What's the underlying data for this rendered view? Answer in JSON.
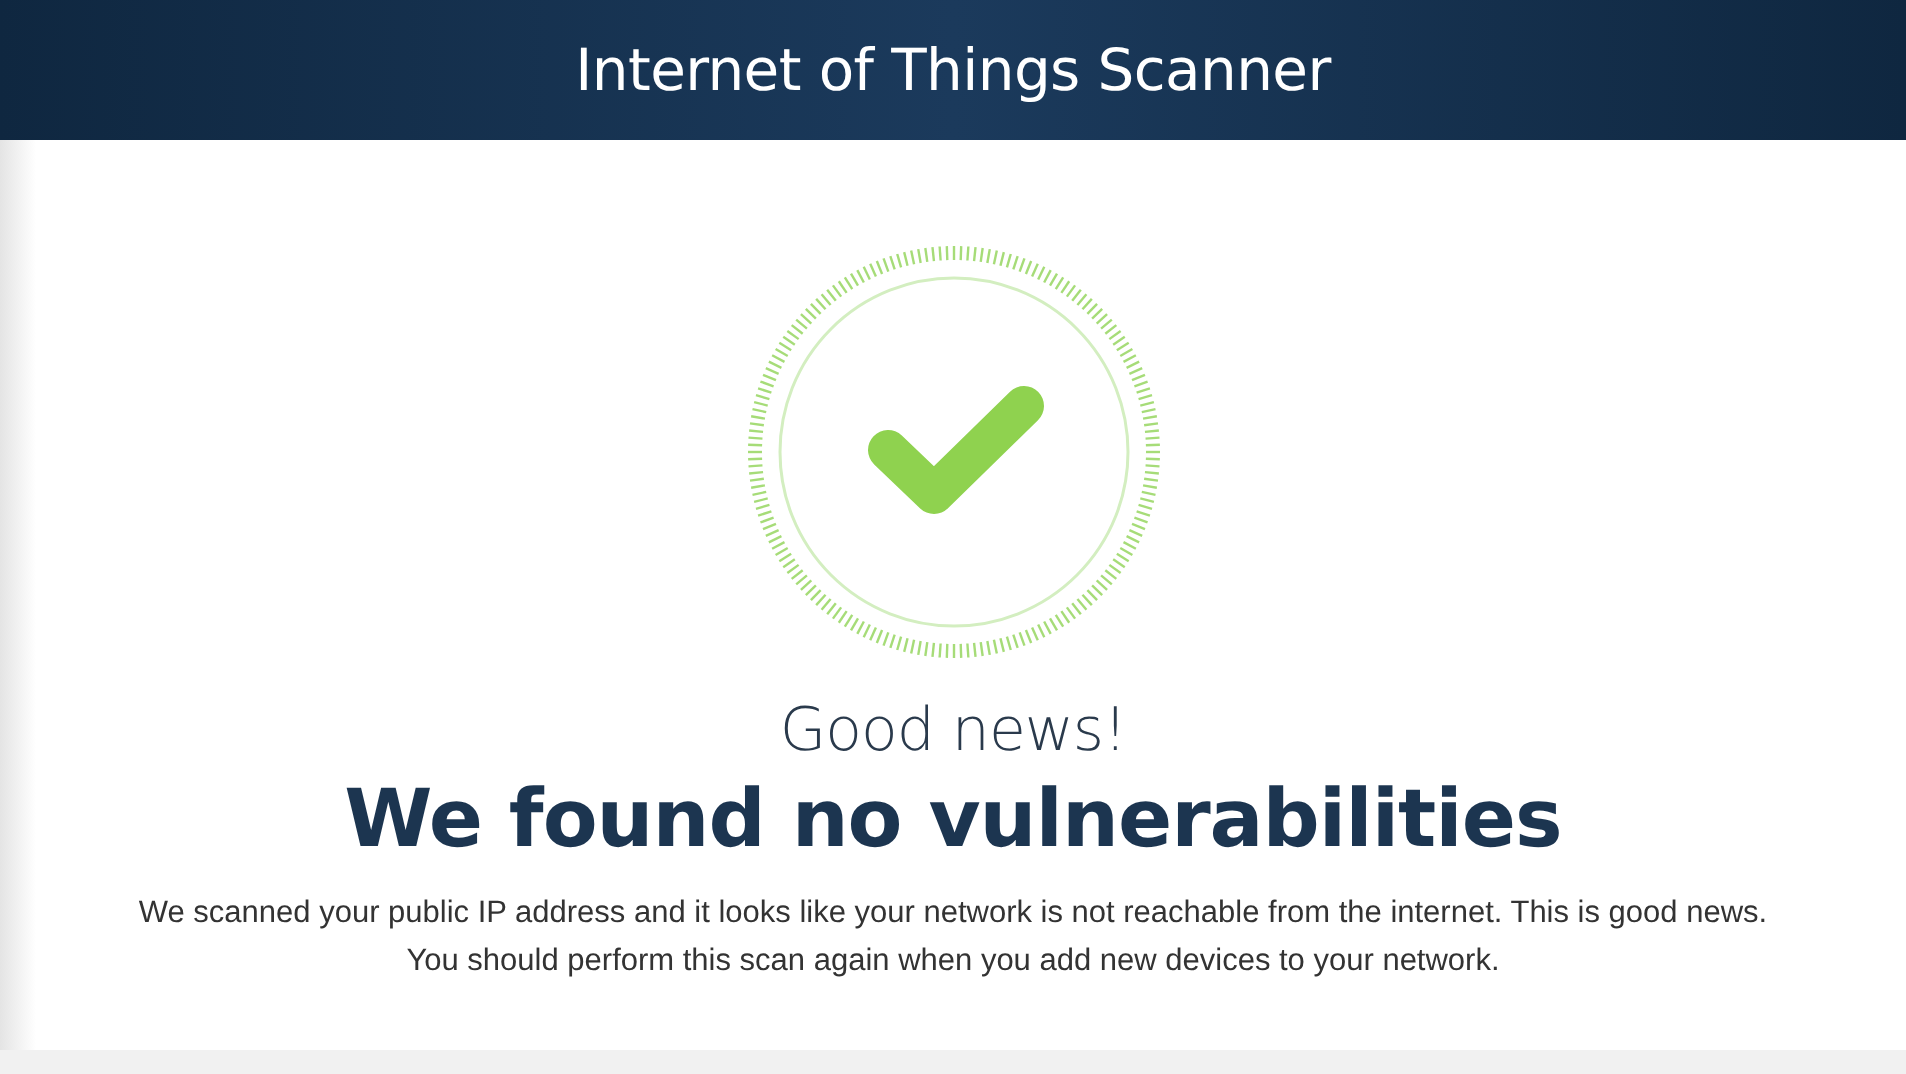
{
  "header": {
    "title": "Internet of Things Scanner"
  },
  "result": {
    "subtitle": "Good news!",
    "headline": "We found no vulnerabilities",
    "message_lines": [
      "We scanned your public IP address and it looks like your network is not reachable from the internet. This is good news.",
      "You should perform this scan again when you add new devices to your network."
    ]
  }
}
